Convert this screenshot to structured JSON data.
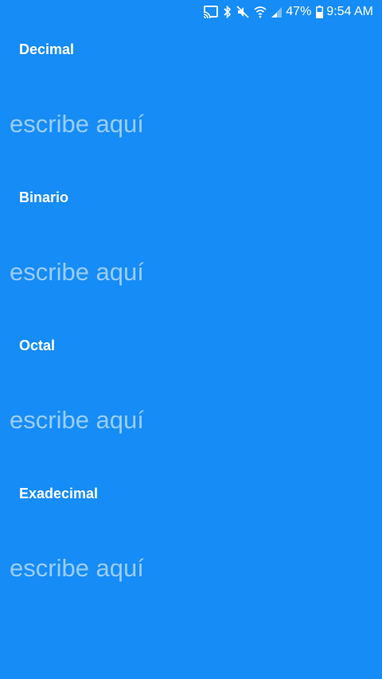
{
  "status_bar": {
    "battery": "47%",
    "time": "9:54 AM",
    "icons": [
      "cast-icon",
      "bluetooth-icon",
      "mute-icon",
      "wifi-icon",
      "signal-icon",
      "battery-icon"
    ]
  },
  "fields": [
    {
      "label": "Decimal",
      "placeholder": "escribe aquí",
      "value": ""
    },
    {
      "label": "Binario",
      "placeholder": "escribe aquí",
      "value": ""
    },
    {
      "label": "Octal",
      "placeholder": "escribe aquí",
      "value": ""
    },
    {
      "label": "Exadecimal",
      "placeholder": "escribe aquí",
      "value": ""
    }
  ],
  "colors": {
    "background": "#168cf7",
    "label": "#ffffff",
    "placeholder": "#9acdfb"
  }
}
